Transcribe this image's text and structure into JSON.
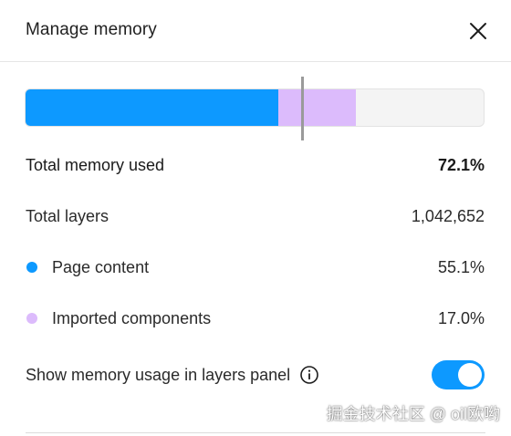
{
  "dialog": {
    "title": "Manage memory"
  },
  "usage_bar": {
    "page_content_fraction": 0.551,
    "imported_fraction": 0.17,
    "marker_fraction": 0.603,
    "colors": {
      "page_content": "#0d99ff",
      "imported": "#dcbbfc",
      "track": "#f4f4f4",
      "marker": "#9a9a9a"
    }
  },
  "stats": {
    "total_memory": {
      "label": "Total memory used",
      "value": "72.1%"
    },
    "total_layers": {
      "label": "Total layers",
      "value": "1,042,652"
    },
    "page_content": {
      "label": "Page content",
      "value": "55.1%",
      "color": "#0d99ff"
    },
    "imported": {
      "label": "Imported components",
      "value": "17.0%",
      "color": "#dcbbfc"
    }
  },
  "settings": {
    "show_in_layers_label": "Show memory usage in layers panel",
    "toggle_on": true,
    "toggle_color": "#0d99ff"
  },
  "watermark": "掘金技术社区 @ oil欧哟"
}
